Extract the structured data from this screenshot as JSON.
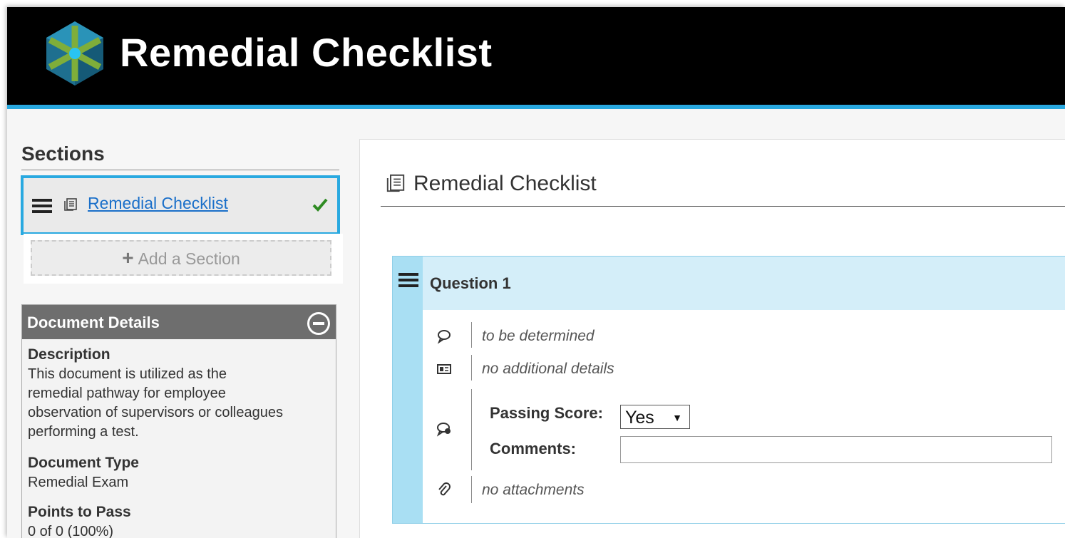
{
  "header": {
    "title": "Remedial Checklist",
    "logo_icon": "hexagon-cube-logo",
    "accent_color": "#29a9e0"
  },
  "sidebar": {
    "sections_title": "Sections",
    "sections": [
      {
        "label": "Remedial Checklist",
        "icon": "document-icon",
        "status": "complete-check"
      }
    ],
    "add_section_label": "Add a Section",
    "details": {
      "title": "Document Details",
      "description_label": "Description",
      "description_value": "This document is utilized as the remedial pathway for employee observation of supervisors or colleagues performing a test.",
      "type_label": "Document Type",
      "type_value": "Remedial Exam",
      "points_label": "Points to Pass",
      "points_value": "0 of 0 (100%)"
    }
  },
  "main": {
    "title": "Remedial Checklist",
    "question": {
      "title": "Question 1",
      "prompt": "to be determined",
      "details": "no additional details",
      "passing_label": "Passing Score:",
      "passing_value": "Yes",
      "comments_label": "Comments:",
      "comments_value": "",
      "attachments": "no attachments"
    }
  }
}
